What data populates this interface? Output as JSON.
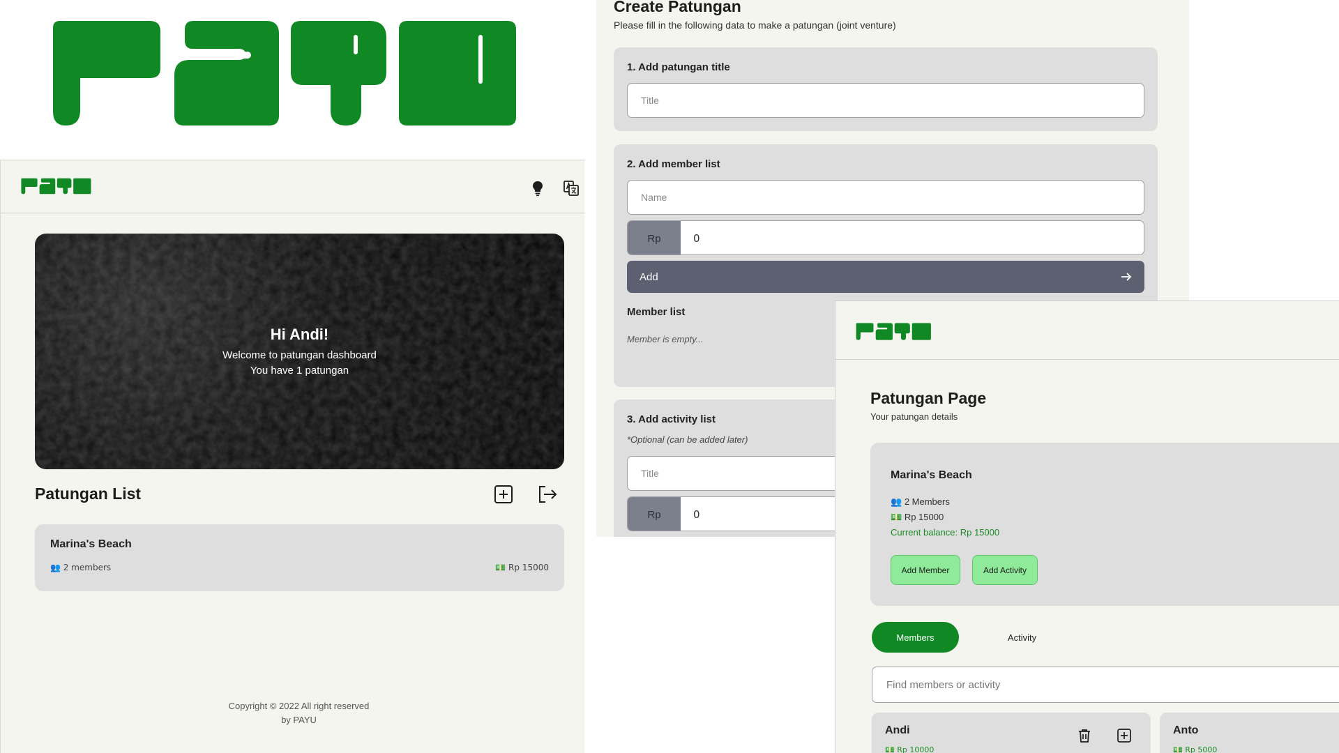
{
  "brand": {
    "color": "#108823",
    "logo_text": "PAYU"
  },
  "dashboard": {
    "hero": {
      "title": "Hi Andi!",
      "line1": "Welcome to patungan dashboard",
      "line2": "You have 1 patungan"
    },
    "list_title": "Patungan List",
    "patungan": [
      {
        "title": "Marina's Beach",
        "members": "2 members",
        "amount": "Rp 15000"
      }
    ],
    "footer": {
      "line1": "Copyright © 2022 All right reserved",
      "line2": "by PAYU"
    },
    "icons": [
      "bulb-icon",
      "translate-icon",
      "add-square-icon",
      "logout-icon"
    ]
  },
  "create": {
    "title": "Create Patungan",
    "subtitle": "Please fill in the following data to make a patungan (joint venture)",
    "section1": {
      "title": "1. Add patungan title",
      "placeholder": "Title"
    },
    "section2": {
      "title": "2. Add member list",
      "name_placeholder": "Name",
      "currency": "Rp",
      "amount_value": "0",
      "add_label": "Add",
      "member_list_title": "Member list",
      "empty_text": "Member is empty..."
    },
    "section3": {
      "title": "3. Add activity list",
      "note": "*Optional (can be added later)",
      "title_placeholder": "Title",
      "currency": "Rp",
      "amount_value": "0"
    }
  },
  "detail": {
    "title": "Patungan Page",
    "subtitle": "Your patungan details",
    "card": {
      "title": "Marina's Beach",
      "members": "2 Members",
      "total": "Rp 15000",
      "balance": "Current balance: Rp 15000",
      "add_member": "Add Member",
      "add_activity": "Add Activity"
    },
    "tabs": {
      "members": "Members",
      "activity": "Activity"
    },
    "search_placeholder": "Find members or activity",
    "members": [
      {
        "name": "Andi",
        "amount": "Rp 10000"
      },
      {
        "name": "Anto",
        "amount": "Rp 5000"
      }
    ]
  }
}
